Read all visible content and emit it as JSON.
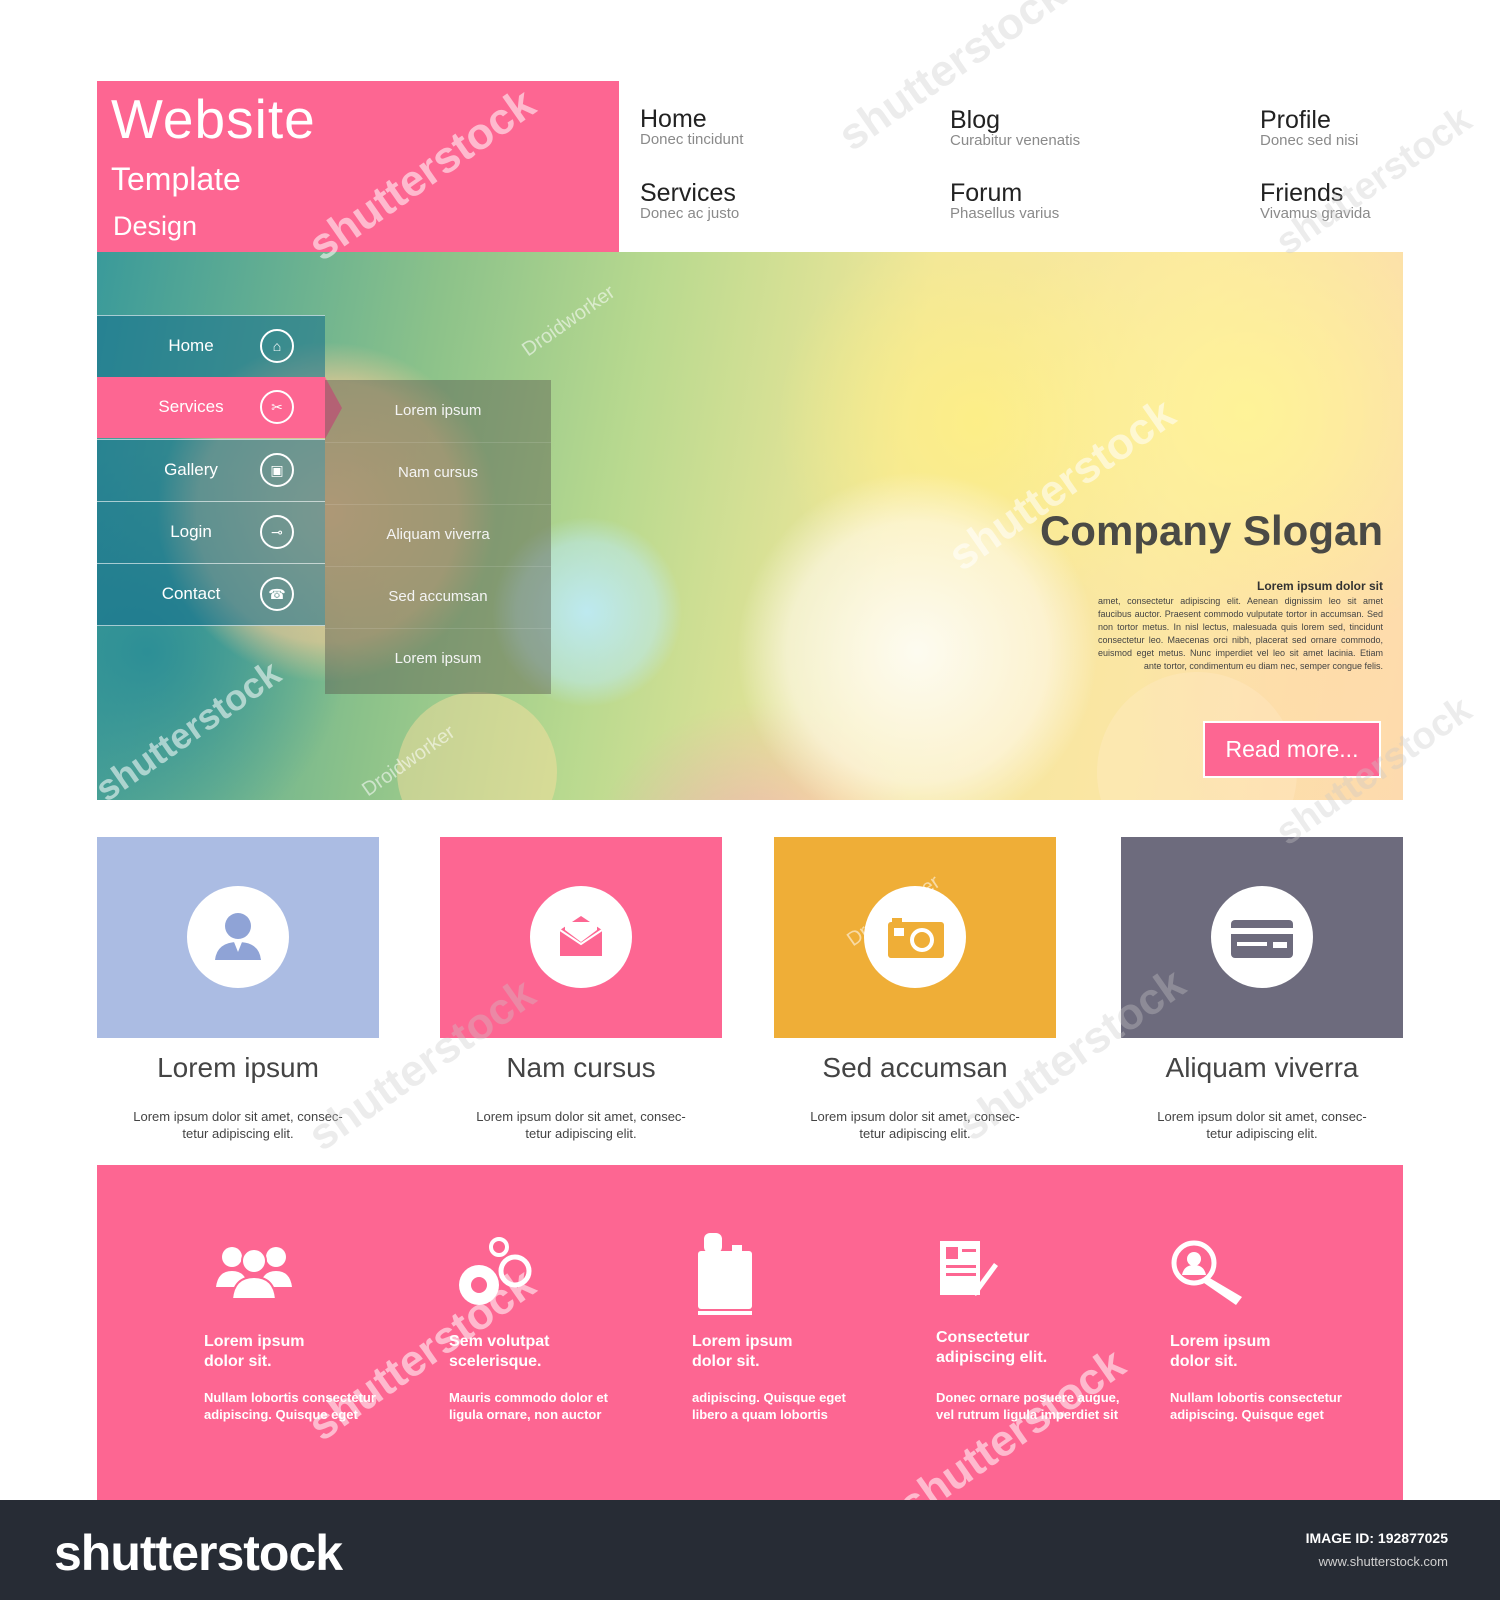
{
  "logo": {
    "line1": "Website",
    "line2": "Template",
    "line3": "Design",
    "color": "#fd6692"
  },
  "top_nav": [
    {
      "title": "Home",
      "subtitle": "Donec tincidunt"
    },
    {
      "title": "Blog",
      "subtitle": "Curabitur venenatis"
    },
    {
      "title": "Profile",
      "subtitle": "Donec sed nisi"
    },
    {
      "title": "Services",
      "subtitle": "Donec ac justo"
    },
    {
      "title": "Forum",
      "subtitle": "Phasellus varius"
    },
    {
      "title": "Friends",
      "subtitle": "Vivamus gravida"
    }
  ],
  "side_menu": {
    "items": [
      {
        "label": "Home",
        "icon": "house-icon"
      },
      {
        "label": "Services",
        "icon": "tools-icon",
        "active": true
      },
      {
        "label": "Gallery",
        "icon": "camera-icon"
      },
      {
        "label": "Login",
        "icon": "key-icon"
      },
      {
        "label": "Contact",
        "icon": "phone-icon"
      }
    ]
  },
  "submenu": [
    "Lorem ipsum",
    "Nam cursus",
    "Aliquam viverra",
    "Sed accumsan",
    "Lorem ipsum"
  ],
  "hero": {
    "slogan": "Company Slogan",
    "heading": "Lorem ipsum dolor sit",
    "body": "amet, consectetur adipiscing elit. Aenean dignissim leo sit amet faucibus auctor. Praesent commodo vulputate tortor in accumsan. Sed non tortor metus. In nisl lectus, malesuada quis lorem sed, tincidunt consectetur leo. Maecenas orci nibh, placerat sed ornare commodo, euismod eget metus. Nunc imperdiet vel leo sit amet lacinia. Etiam ante tortor, condimentum eu diam nec, semper congue felis.",
    "button": "Read more..."
  },
  "tiles": [
    {
      "title": "Lorem ipsum",
      "desc_line1": "Lorem ipsum dolor sit amet, consec-",
      "desc_line2": "tetur adipiscing elit.",
      "color": "#abbce3",
      "icon": "user-icon"
    },
    {
      "title": "Nam cursus",
      "desc_line1": "Lorem ipsum dolor sit amet, consec-",
      "desc_line2": "tetur adipiscing elit.",
      "color": "#fd6692",
      "icon": "mail-icon"
    },
    {
      "title": "Sed accumsan",
      "desc_line1": "Lorem ipsum dolor sit amet, consec-",
      "desc_line2": "tetur adipiscing elit.",
      "color": "#efae37",
      "icon": "camera-icon"
    },
    {
      "title": "Aliquam viverra",
      "desc_line1": "Lorem ipsum dolor sit amet, consec-",
      "desc_line2": "tetur adipiscing elit.",
      "color": "#6d6b7d",
      "icon": "credit-card-icon"
    }
  ],
  "features": [
    {
      "h1": "Lorem ipsum",
      "h2": "dolor sit.",
      "b1": "Nullam lobortis consectetur",
      "b2": "adipiscing. Quisque eget",
      "icon": "group-icon"
    },
    {
      "h1": "Sem volutpat",
      "h2": "scelerisque.",
      "b1": "Mauris commodo dolor et",
      "b2": "ligula ornare, non auctor",
      "icon": "gears-icon"
    },
    {
      "h1": "Lorem ipsum",
      "h2": "dolor sit.",
      "b1": "adipiscing. Quisque eget",
      "b2": "libero a quam lobortis",
      "icon": "phone-icon"
    },
    {
      "h1": "Consectetur",
      "h2": "adipiscing elit.",
      "b1": "Donec ornare posuere augue,",
      "b2": "vel rutrum ligula imperdiet sit",
      "icon": "document-icon"
    },
    {
      "h1": "Lorem ipsum",
      "h2": "dolor sit.",
      "b1": "Nullam lobortis consectetur",
      "b2": "adipiscing. Quisque eget",
      "icon": "search-user-icon"
    }
  ],
  "footer": {
    "brand": "shutterstock",
    "image_id_label": "IMAGE ID:",
    "image_id": "192877025",
    "url": "www.shutterstock.com"
  },
  "watermarks": {
    "brand": "shutterstock",
    "author": "Droidworker"
  }
}
